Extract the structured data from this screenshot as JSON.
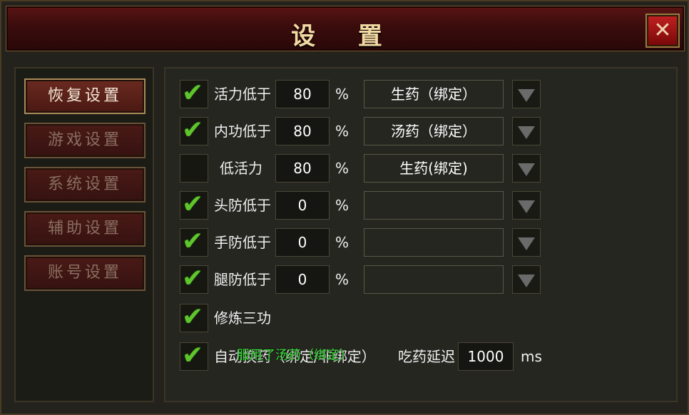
{
  "window": {
    "title": "设 置",
    "close_label": "✕"
  },
  "sidebar": {
    "items": [
      {
        "label": "恢复设置"
      },
      {
        "label": "游戏设置"
      },
      {
        "label": "系统设置"
      },
      {
        "label": "辅助设置"
      },
      {
        "label": "账号设置"
      }
    ],
    "active_index": 0
  },
  "recovery": {
    "rows": [
      {
        "checked": true,
        "label": "活力低于",
        "value": "80",
        "unit": "%",
        "item": "生药（绑定）"
      },
      {
        "checked": true,
        "label": "内功低于",
        "value": "80",
        "unit": "%",
        "item": "汤药（绑定）"
      },
      {
        "checked": false,
        "label": "低活力",
        "value": "80",
        "unit": "%",
        "item": "生药(绑定)"
      },
      {
        "checked": true,
        "label": "头防低于",
        "value": "0",
        "unit": "%",
        "item": ""
      },
      {
        "checked": true,
        "label": "手防低于",
        "value": "0",
        "unit": "%",
        "item": ""
      },
      {
        "checked": true,
        "label": "腿防低于",
        "value": "0",
        "unit": "%",
        "item": ""
      }
    ],
    "train": {
      "checked": true,
      "label": "修炼三功"
    },
    "auto_switch": {
      "checked": true,
      "label": "自动换药（绑定/非绑定）"
    },
    "delay": {
      "label": "吃药延迟",
      "value": "1000",
      "unit": "ms"
    },
    "toast": "服用了汤药（绑定）"
  },
  "colors": {
    "title_bar": "#4a1010",
    "check_green": "#5fc52c",
    "toast_green": "#2fd62f"
  },
  "icons": {
    "check": "✔",
    "dropdown": "triangle-down"
  }
}
